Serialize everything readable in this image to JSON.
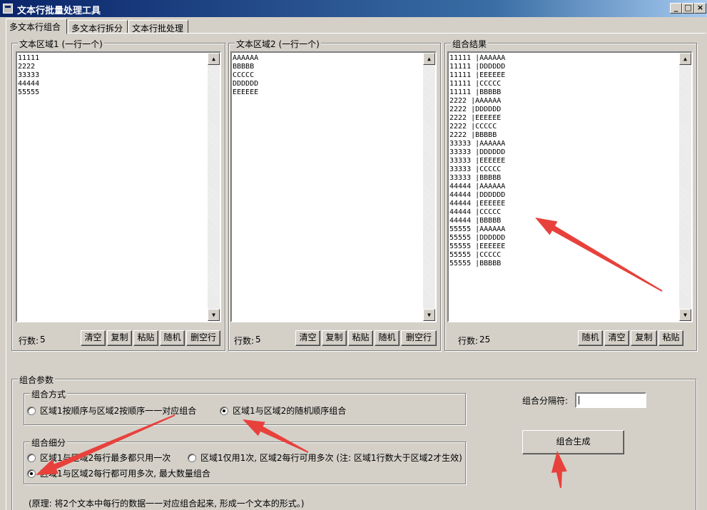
{
  "window": {
    "title": "文本行批量处理工具",
    "minimize": "_",
    "maximize": "□",
    "close": "×"
  },
  "tabs": [
    {
      "label": "多文本行组合",
      "active": true
    },
    {
      "label": "多文本行拆分",
      "active": false
    },
    {
      "label": "文本行批处理",
      "active": false
    }
  ],
  "area1": {
    "label": "文本区域1 (一行一个)",
    "lines": [
      "11111",
      "2222",
      "33333",
      "44444",
      "55555"
    ],
    "count_label": "行数:",
    "count": "5",
    "buttons": [
      "清空",
      "复制",
      "粘贴",
      "随机",
      "删空行"
    ]
  },
  "area2": {
    "label": "文本区域2 (一行一个)",
    "lines": [
      "AAAAAA",
      "BBBBB",
      "CCCCC",
      "DDDDDD",
      "EEEEEE"
    ],
    "count_label": "行数:",
    "count": "5",
    "buttons": [
      "清空",
      "复制",
      "粘贴",
      "随机",
      "删空行"
    ]
  },
  "result": {
    "label": "组合结果",
    "lines": [
      "11111 |AAAAAA",
      "11111 |DDDDDD",
      "11111 |EEEEEE",
      "11111 |CCCCC",
      "11111 |BBBBB",
      "2222 |AAAAAA",
      "2222 |DDDDDD",
      "2222 |EEEEEE",
      "2222 |CCCCC",
      "2222 |BBBBB",
      "33333 |AAAAAA",
      "33333 |DDDDDD",
      "33333 |EEEEEE",
      "33333 |CCCCC",
      "33333 |BBBBB",
      "44444 |AAAAAA",
      "44444 |DDDDDD",
      "44444 |EEEEEE",
      "44444 |CCCCC",
      "44444 |BBBBB",
      "55555 |AAAAAA",
      "55555 |DDDDDD",
      "55555 |EEEEEE",
      "55555 |CCCCC",
      "55555 |BBBBB"
    ],
    "count_label": "行数:",
    "count": "25",
    "buttons": [
      "随机",
      "清空",
      "复制",
      "粘贴"
    ]
  },
  "params": {
    "label": "组合参数",
    "mode": {
      "label": "组合方式",
      "options": [
        {
          "label": "区域1按顺序与区域2按顺序一一对应组合",
          "selected": false
        },
        {
          "label": "区域1与区域2的随机顺序组合",
          "selected": true
        }
      ]
    },
    "detail": {
      "label": "组合细分",
      "options": [
        {
          "label": "区域1与区域2每行最多都只用一次",
          "selected": false
        },
        {
          "label": "区域1仅用1次, 区域2每行可用多次 (注: 区域1行数大于区域2才生效)",
          "selected": false
        },
        {
          "label": "区域1与区域2每行都可用多次, 最大数量组合",
          "selected": true
        }
      ]
    },
    "separator_label": "组合分隔符:",
    "separator_value": "",
    "generate_label": "组合生成",
    "note": "(原理: 将2个文本中每行的数据一一对应组合起来, 形成一个文本的形式。)"
  },
  "annotation_color": "#e8413c"
}
